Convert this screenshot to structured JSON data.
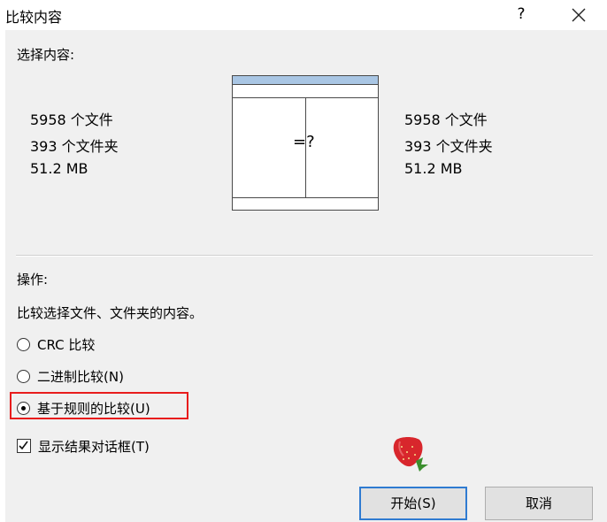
{
  "window": {
    "title": "比较内容",
    "help_symbol": "?",
    "close_icon": "close-icon"
  },
  "selection": {
    "heading": "选择内容:",
    "left": {
      "files": "5958 个文件",
      "folders": "393 个文件夹",
      "size": "51.2 MB"
    },
    "right": {
      "files": "5958 个文件",
      "folders": "393 个文件夹",
      "size": "51.2 MB"
    },
    "diagram_mark": "=?"
  },
  "operation": {
    "heading": "操作:",
    "description": "比较选择文件、文件夹的内容。",
    "options": [
      {
        "label": "CRC 比较",
        "selected": false
      },
      {
        "label": "二进制比较(N)",
        "selected": false
      },
      {
        "label": "基于规则的比较(U)",
        "selected": true
      }
    ],
    "show_results_dialog": {
      "label": "显示结果对话框(T)",
      "checked": true
    }
  },
  "buttons": {
    "start": "开始(S)",
    "cancel": "取消"
  },
  "colors": {
    "highlight": "#e81c1c",
    "default_button_border": "#2f7bd1",
    "diagram_header": "#a9c6e4"
  }
}
